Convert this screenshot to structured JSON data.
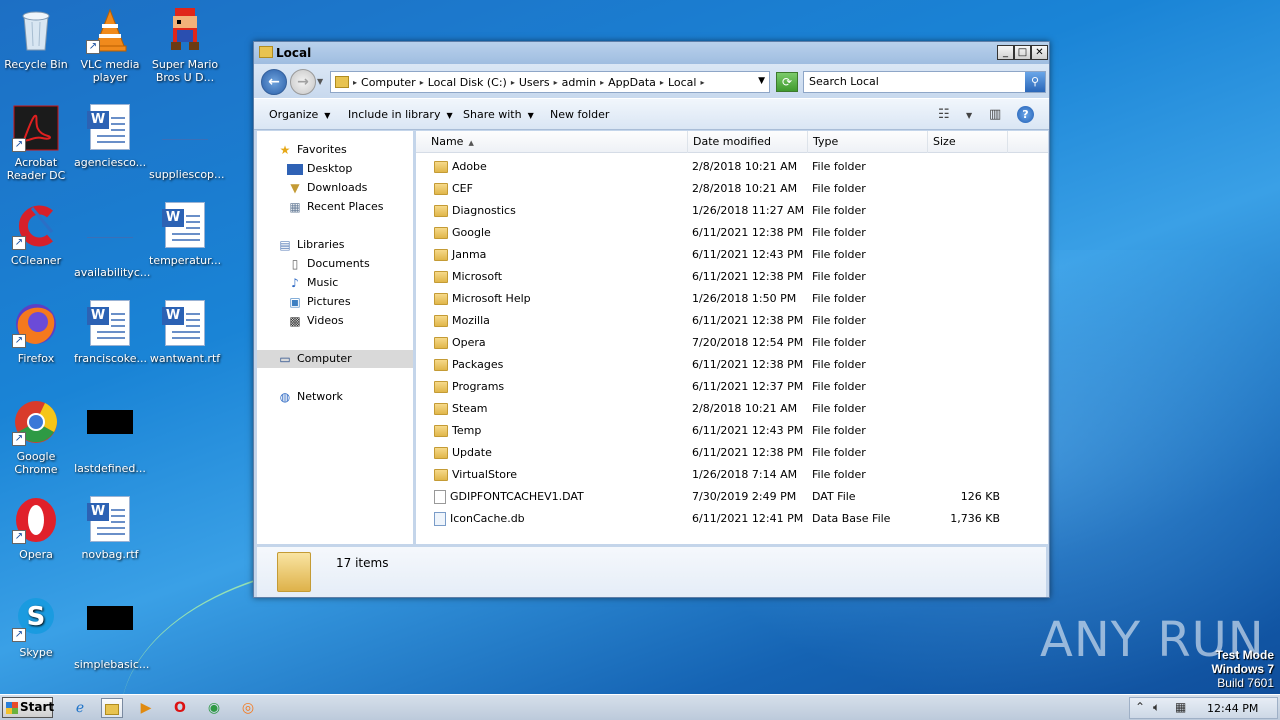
{
  "desktop": {
    "icons": [
      {
        "label": "Recycle Bin",
        "icon": "recycle-bin-icon"
      },
      {
        "label": "VLC media player",
        "icon": "vlc-icon"
      },
      {
        "label": "Super Mario Bros U D...",
        "icon": "mario-icon"
      },
      {
        "label": "Acrobat Reader DC",
        "icon": "acrobat-icon"
      },
      {
        "label": "agenciesco...",
        "icon": "word-doc-icon"
      },
      {
        "label": "suppliescop...",
        "icon": "blank-file-icon"
      },
      {
        "label": "CCleaner",
        "icon": "ccleaner-icon"
      },
      {
        "label": "availabilityc...",
        "icon": "blank-file-icon"
      },
      {
        "label": "temperatur...",
        "icon": "word-doc-icon"
      },
      {
        "label": "Firefox",
        "icon": "firefox-icon"
      },
      {
        "label": "franciscoke...",
        "icon": "word-doc-icon"
      },
      {
        "label": "wantwant.rtf",
        "icon": "word-doc-icon"
      },
      {
        "label": "Google Chrome",
        "icon": "chrome-icon"
      },
      {
        "label": "lastdefined...",
        "icon": "black-file-icon"
      },
      {
        "label": "Opera",
        "icon": "opera-icon"
      },
      {
        "label": "novbag.rtf",
        "icon": "word-doc-icon"
      },
      {
        "label": "Skype",
        "icon": "skype-icon"
      },
      {
        "label": "simplebasic...",
        "icon": "black-file-icon"
      }
    ]
  },
  "window": {
    "title": "Local",
    "controls": {
      "minimize": "_",
      "maximize": "□",
      "close": "✕"
    },
    "address": {
      "crumbs": [
        "Computer",
        "Local Disk (C:)",
        "Users",
        "admin",
        "AppData",
        "Local"
      ],
      "placeholder": "Search Local"
    },
    "toolbar": {
      "organize": "Organize",
      "include_in_library": "Include in library",
      "share_with": "Share with",
      "new_folder": "New folder"
    },
    "nav": {
      "favorites": "Favorites",
      "desktop": "Desktop",
      "downloads": "Downloads",
      "recent_places": "Recent Places",
      "libraries": "Libraries",
      "documents": "Documents",
      "music": "Music",
      "pictures": "Pictures",
      "videos": "Videos",
      "computer": "Computer",
      "network": "Network"
    },
    "columns": {
      "name": "Name",
      "date_modified": "Date modified",
      "type": "Type",
      "size": "Size"
    },
    "files": [
      {
        "name": "Adobe",
        "date": "2/8/2018 10:21 AM",
        "type": "File folder",
        "size": "",
        "kind": "folder"
      },
      {
        "name": "CEF",
        "date": "2/8/2018 10:21 AM",
        "type": "File folder",
        "size": "",
        "kind": "folder"
      },
      {
        "name": "Diagnostics",
        "date": "1/26/2018 11:27 AM",
        "type": "File folder",
        "size": "",
        "kind": "folder"
      },
      {
        "name": "Google",
        "date": "6/11/2021 12:38 PM",
        "type": "File folder",
        "size": "",
        "kind": "folder"
      },
      {
        "name": "Janma",
        "date": "6/11/2021 12:43 PM",
        "type": "File folder",
        "size": "",
        "kind": "folder"
      },
      {
        "name": "Microsoft",
        "date": "6/11/2021 12:38 PM",
        "type": "File folder",
        "size": "",
        "kind": "folder"
      },
      {
        "name": "Microsoft Help",
        "date": "1/26/2018 1:50 PM",
        "type": "File folder",
        "size": "",
        "kind": "folder"
      },
      {
        "name": "Mozilla",
        "date": "6/11/2021 12:38 PM",
        "type": "File folder",
        "size": "",
        "kind": "folder"
      },
      {
        "name": "Opera",
        "date": "7/20/2018 12:54 PM",
        "type": "File folder",
        "size": "",
        "kind": "folder"
      },
      {
        "name": "Packages",
        "date": "6/11/2021 12:38 PM",
        "type": "File folder",
        "size": "",
        "kind": "folder"
      },
      {
        "name": "Programs",
        "date": "6/11/2021 12:37 PM",
        "type": "File folder",
        "size": "",
        "kind": "folder"
      },
      {
        "name": "Steam",
        "date": "2/8/2018 10:21 AM",
        "type": "File folder",
        "size": "",
        "kind": "folder"
      },
      {
        "name": "Temp",
        "date": "6/11/2021 12:43 PM",
        "type": "File folder",
        "size": "",
        "kind": "folder"
      },
      {
        "name": "Update",
        "date": "6/11/2021 12:38 PM",
        "type": "File folder",
        "size": "",
        "kind": "folder"
      },
      {
        "name": "VirtualStore",
        "date": "1/26/2018 7:14 AM",
        "type": "File folder",
        "size": "",
        "kind": "folder"
      },
      {
        "name": "GDIPFONTCACHEV1.DAT",
        "date": "7/30/2019 2:49 PM",
        "type": "DAT File",
        "size": "126 KB",
        "kind": "file"
      },
      {
        "name": "IconCache.db",
        "date": "6/11/2021 12:41 PM",
        "type": "Data Base File",
        "size": "1,736 KB",
        "kind": "db"
      }
    ],
    "status": {
      "item_count": "17 items"
    }
  },
  "watermark": "ANY RUN",
  "testmode": {
    "line1": "Test Mode",
    "line2": "Windows 7",
    "line3": "Build 7601"
  },
  "taskbar": {
    "start": "Start",
    "pinned": [
      "ie-icon",
      "explorer-icon",
      "media-player-icon",
      "opera-icon",
      "chrome-icon",
      "firefox-icon"
    ],
    "clock": "12:44 PM"
  }
}
